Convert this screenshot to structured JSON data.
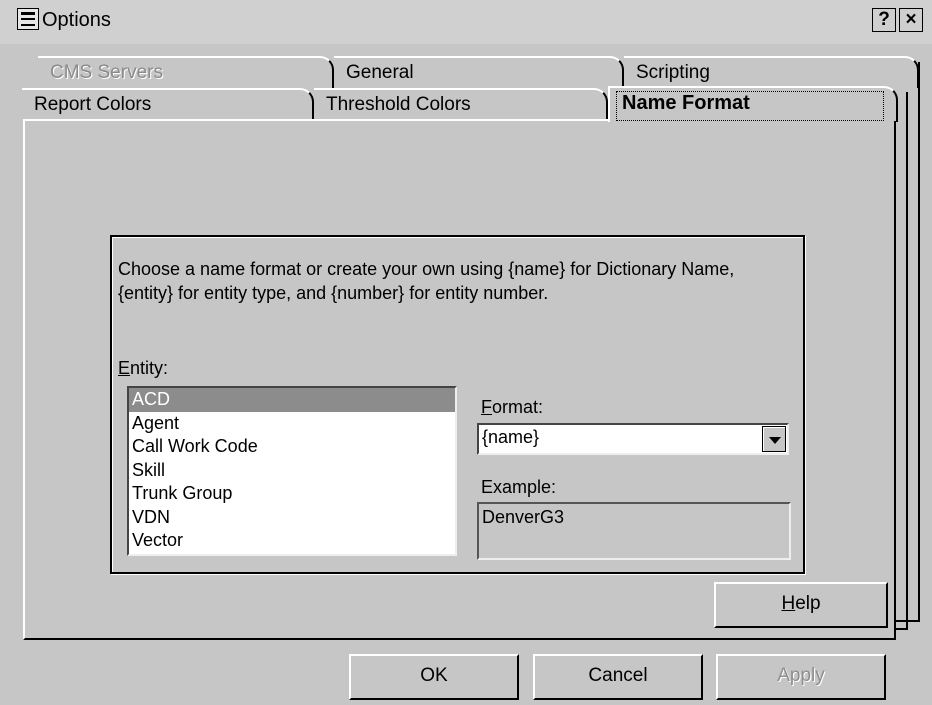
{
  "window": {
    "title": "Options",
    "help_glyph": "?",
    "close_glyph": "×"
  },
  "tabs": {
    "back_row": [
      {
        "label": "CMS Servers",
        "disabled": true
      },
      {
        "label": "General"
      },
      {
        "label": "Scripting"
      }
    ],
    "front_row": [
      {
        "label": "Report Colors"
      },
      {
        "label": "Threshold Colors"
      },
      {
        "label": "Name Format",
        "active": true
      }
    ]
  },
  "name_format": {
    "description_line1": "Choose a name format or create your own using {name} for Dictionary Name,",
    "description_line2": "{entity} for entity type, and {number} for entity number.",
    "entity_label_mnemonic": "E",
    "entity_label_rest": "ntity:",
    "entity_items": [
      "ACD",
      "Agent",
      "Call Work Code",
      "Skill",
      "Trunk Group",
      "VDN",
      "Vector"
    ],
    "selected_entity": "ACD",
    "format_label_mnemonic": "F",
    "format_label_rest": "ormat:",
    "format_value": "{name}",
    "example_label": "Example:",
    "example_value": "DenverG3"
  },
  "buttons": {
    "help_mnemonic": "H",
    "help_rest": "elp",
    "ok": "OK",
    "cancel": "Cancel",
    "apply": "Apply"
  },
  "colors": {
    "face": "#c6c6c6",
    "selection": "#8c8c8c"
  }
}
